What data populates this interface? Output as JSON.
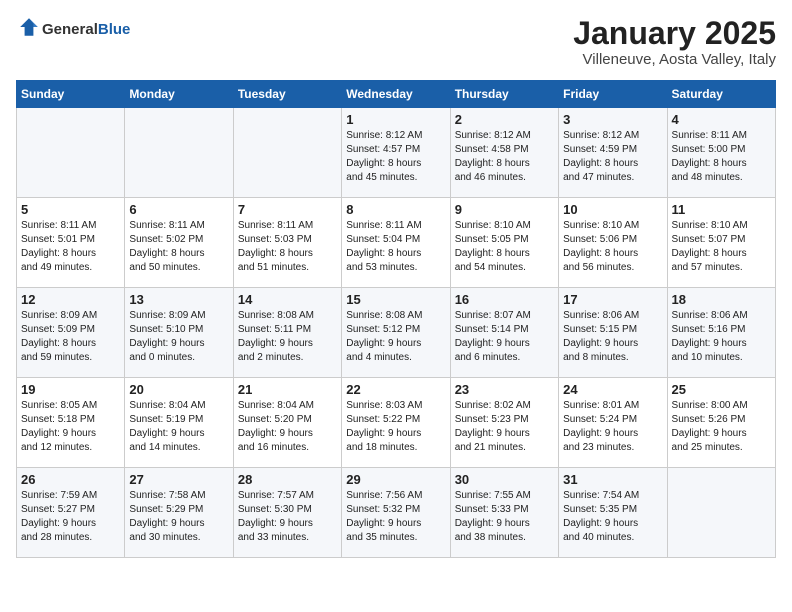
{
  "logo": {
    "general": "General",
    "blue": "Blue"
  },
  "title": "January 2025",
  "subtitle": "Villeneuve, Aosta Valley, Italy",
  "days_of_week": [
    "Sunday",
    "Monday",
    "Tuesday",
    "Wednesday",
    "Thursday",
    "Friday",
    "Saturday"
  ],
  "weeks": [
    [
      {
        "day": "",
        "info": ""
      },
      {
        "day": "",
        "info": ""
      },
      {
        "day": "",
        "info": ""
      },
      {
        "day": "1",
        "info": "Sunrise: 8:12 AM\nSunset: 4:57 PM\nDaylight: 8 hours\nand 45 minutes."
      },
      {
        "day": "2",
        "info": "Sunrise: 8:12 AM\nSunset: 4:58 PM\nDaylight: 8 hours\nand 46 minutes."
      },
      {
        "day": "3",
        "info": "Sunrise: 8:12 AM\nSunset: 4:59 PM\nDaylight: 8 hours\nand 47 minutes."
      },
      {
        "day": "4",
        "info": "Sunrise: 8:11 AM\nSunset: 5:00 PM\nDaylight: 8 hours\nand 48 minutes."
      }
    ],
    [
      {
        "day": "5",
        "info": "Sunrise: 8:11 AM\nSunset: 5:01 PM\nDaylight: 8 hours\nand 49 minutes."
      },
      {
        "day": "6",
        "info": "Sunrise: 8:11 AM\nSunset: 5:02 PM\nDaylight: 8 hours\nand 50 minutes."
      },
      {
        "day": "7",
        "info": "Sunrise: 8:11 AM\nSunset: 5:03 PM\nDaylight: 8 hours\nand 51 minutes."
      },
      {
        "day": "8",
        "info": "Sunrise: 8:11 AM\nSunset: 5:04 PM\nDaylight: 8 hours\nand 53 minutes."
      },
      {
        "day": "9",
        "info": "Sunrise: 8:10 AM\nSunset: 5:05 PM\nDaylight: 8 hours\nand 54 minutes."
      },
      {
        "day": "10",
        "info": "Sunrise: 8:10 AM\nSunset: 5:06 PM\nDaylight: 8 hours\nand 56 minutes."
      },
      {
        "day": "11",
        "info": "Sunrise: 8:10 AM\nSunset: 5:07 PM\nDaylight: 8 hours\nand 57 minutes."
      }
    ],
    [
      {
        "day": "12",
        "info": "Sunrise: 8:09 AM\nSunset: 5:09 PM\nDaylight: 8 hours\nand 59 minutes."
      },
      {
        "day": "13",
        "info": "Sunrise: 8:09 AM\nSunset: 5:10 PM\nDaylight: 9 hours\nand 0 minutes."
      },
      {
        "day": "14",
        "info": "Sunrise: 8:08 AM\nSunset: 5:11 PM\nDaylight: 9 hours\nand 2 minutes."
      },
      {
        "day": "15",
        "info": "Sunrise: 8:08 AM\nSunset: 5:12 PM\nDaylight: 9 hours\nand 4 minutes."
      },
      {
        "day": "16",
        "info": "Sunrise: 8:07 AM\nSunset: 5:14 PM\nDaylight: 9 hours\nand 6 minutes."
      },
      {
        "day": "17",
        "info": "Sunrise: 8:06 AM\nSunset: 5:15 PM\nDaylight: 9 hours\nand 8 minutes."
      },
      {
        "day": "18",
        "info": "Sunrise: 8:06 AM\nSunset: 5:16 PM\nDaylight: 9 hours\nand 10 minutes."
      }
    ],
    [
      {
        "day": "19",
        "info": "Sunrise: 8:05 AM\nSunset: 5:18 PM\nDaylight: 9 hours\nand 12 minutes."
      },
      {
        "day": "20",
        "info": "Sunrise: 8:04 AM\nSunset: 5:19 PM\nDaylight: 9 hours\nand 14 minutes."
      },
      {
        "day": "21",
        "info": "Sunrise: 8:04 AM\nSunset: 5:20 PM\nDaylight: 9 hours\nand 16 minutes."
      },
      {
        "day": "22",
        "info": "Sunrise: 8:03 AM\nSunset: 5:22 PM\nDaylight: 9 hours\nand 18 minutes."
      },
      {
        "day": "23",
        "info": "Sunrise: 8:02 AM\nSunset: 5:23 PM\nDaylight: 9 hours\nand 21 minutes."
      },
      {
        "day": "24",
        "info": "Sunrise: 8:01 AM\nSunset: 5:24 PM\nDaylight: 9 hours\nand 23 minutes."
      },
      {
        "day": "25",
        "info": "Sunrise: 8:00 AM\nSunset: 5:26 PM\nDaylight: 9 hours\nand 25 minutes."
      }
    ],
    [
      {
        "day": "26",
        "info": "Sunrise: 7:59 AM\nSunset: 5:27 PM\nDaylight: 9 hours\nand 28 minutes."
      },
      {
        "day": "27",
        "info": "Sunrise: 7:58 AM\nSunset: 5:29 PM\nDaylight: 9 hours\nand 30 minutes."
      },
      {
        "day": "28",
        "info": "Sunrise: 7:57 AM\nSunset: 5:30 PM\nDaylight: 9 hours\nand 33 minutes."
      },
      {
        "day": "29",
        "info": "Sunrise: 7:56 AM\nSunset: 5:32 PM\nDaylight: 9 hours\nand 35 minutes."
      },
      {
        "day": "30",
        "info": "Sunrise: 7:55 AM\nSunset: 5:33 PM\nDaylight: 9 hours\nand 38 minutes."
      },
      {
        "day": "31",
        "info": "Sunrise: 7:54 AM\nSunset: 5:35 PM\nDaylight: 9 hours\nand 40 minutes."
      },
      {
        "day": "",
        "info": ""
      }
    ]
  ]
}
